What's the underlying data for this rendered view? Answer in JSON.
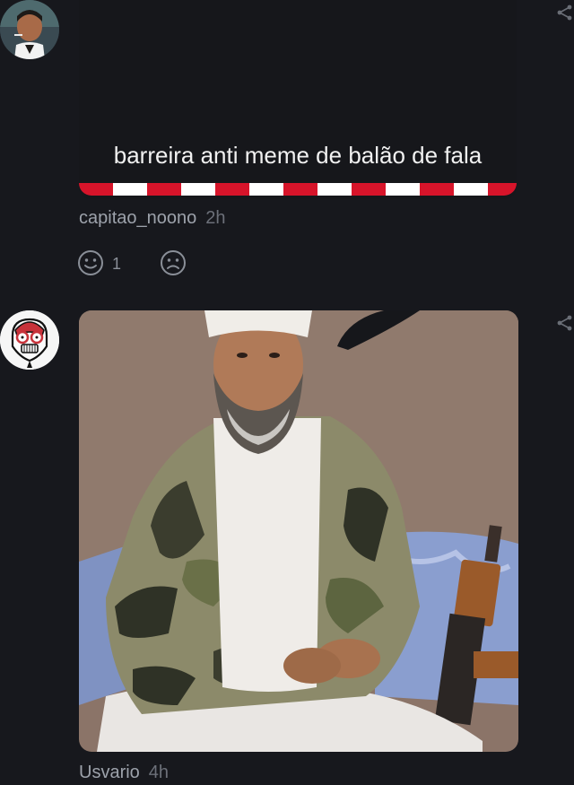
{
  "posts": [
    {
      "meme_text": "barreira anti meme de balão de fala",
      "username": "capitao_noono",
      "time": "2h",
      "like_count": "1"
    },
    {
      "username": "Usvario",
      "time": "4h"
    }
  ],
  "icons": {
    "share": "share-icon",
    "like": "smile-reaction-icon",
    "dislike": "frown-reaction-icon"
  },
  "colors": {
    "background": "#17181d",
    "barrier_red": "#d7142a",
    "barrier_white": "#ffffff"
  }
}
